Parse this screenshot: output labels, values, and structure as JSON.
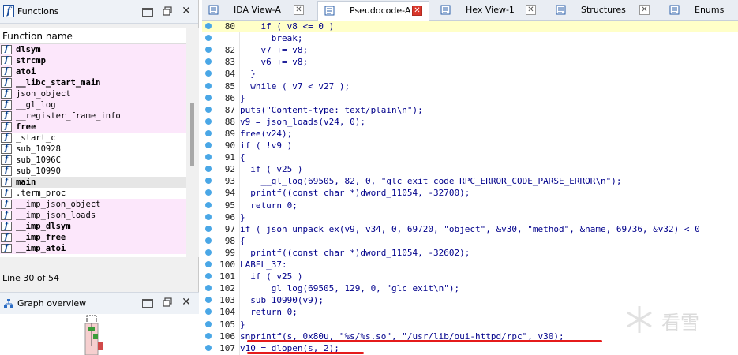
{
  "functions_panel": {
    "title": "Functions",
    "header": "Function name",
    "status": "Line 30 of 54",
    "items": [
      {
        "name": "dlsym",
        "bold": true,
        "pink": true
      },
      {
        "name": "strcmp",
        "bold": true,
        "pink": true
      },
      {
        "name": "atoi",
        "bold": true,
        "pink": true
      },
      {
        "name": "__libc_start_main",
        "bold": true,
        "pink": true
      },
      {
        "name": "json_object",
        "bold": false,
        "pink": true
      },
      {
        "name": "__gl_log",
        "bold": false,
        "pink": true
      },
      {
        "name": "__register_frame_info",
        "bold": false,
        "pink": true
      },
      {
        "name": "free",
        "bold": true,
        "pink": true
      },
      {
        "name": "_start_c",
        "bold": false,
        "pink": false
      },
      {
        "name": "sub_10928",
        "bold": false,
        "pink": false
      },
      {
        "name": "sub_1096C",
        "bold": false,
        "pink": false
      },
      {
        "name": "sub_10990",
        "bold": false,
        "pink": false
      },
      {
        "name": "main",
        "bold": true,
        "pink": false,
        "selected": true
      },
      {
        "name": ".term_proc",
        "bold": false,
        "pink": false
      },
      {
        "name": "__imp_json_object",
        "bold": false,
        "pink": true
      },
      {
        "name": "__imp_json_loads",
        "bold": false,
        "pink": true
      },
      {
        "name": "__imp_dlsym",
        "bold": true,
        "pink": true
      },
      {
        "name": "__imp_free",
        "bold": true,
        "pink": true
      },
      {
        "name": "__imp_atoi",
        "bold": true,
        "pink": true
      }
    ]
  },
  "graph_panel": {
    "title": "Graph overview"
  },
  "tabs": [
    {
      "label": "IDA View-A",
      "icon": "ida-view-icon",
      "active": false
    },
    {
      "label": "Pseudocode-A",
      "icon": "pseudocode-icon",
      "active": true
    },
    {
      "label": "Hex View-1",
      "icon": "hex-view-icon",
      "active": false
    },
    {
      "label": "Structures",
      "icon": "structures-icon",
      "active": false
    },
    {
      "label": "Enums",
      "icon": "enums-icon",
      "active": false
    }
  ],
  "code": [
    {
      "n": "80",
      "t": "    if ( v8 <= 0 )",
      "hl": true
    },
    {
      "n": "",
      "t": "      break;"
    },
    {
      "n": "82",
      "t": "    v7 += v8;"
    },
    {
      "n": "83",
      "t": "    v6 += v8;"
    },
    {
      "n": "84",
      "t": "  }"
    },
    {
      "n": "85",
      "t": "  while ( v7 < v27 );"
    },
    {
      "n": "86",
      "t": "}"
    },
    {
      "n": "87",
      "t": "puts(\"Content-type: text/plain\\n\");"
    },
    {
      "n": "88",
      "t": "v9 = json_loads(v24, 0);"
    },
    {
      "n": "89",
      "t": "free(v24);"
    },
    {
      "n": "90",
      "t": "if ( !v9 )"
    },
    {
      "n": "91",
      "t": "{"
    },
    {
      "n": "92",
      "t": "  if ( v25 )"
    },
    {
      "n": "93",
      "t": "    __gl_log(69505, 82, 0, \"glc exit code RPC_ERROR_CODE_PARSE_ERROR\\n\");"
    },
    {
      "n": "94",
      "t": "  printf((const char *)dword_11054, -32700);"
    },
    {
      "n": "95",
      "t": "  return 0;"
    },
    {
      "n": "96",
      "t": "}"
    },
    {
      "n": "97",
      "t": "if ( json_unpack_ex(v9, v34, 0, 69720, \"object\", &v30, \"method\", &name, 69736, &v32) < 0"
    },
    {
      "n": "98",
      "t": "{"
    },
    {
      "n": "99",
      "t": "  printf((const char *)dword_11054, -32602);"
    },
    {
      "n": "100",
      "t": "LABEL_37:"
    },
    {
      "n": "101",
      "t": "  if ( v25 )"
    },
    {
      "n": "102",
      "t": "    __gl_log(69505, 129, 0, \"glc exit\\n\");"
    },
    {
      "n": "103",
      "t": "  sub_10990(v9);"
    },
    {
      "n": "104",
      "t": "  return 0;"
    },
    {
      "n": "105",
      "t": "}"
    },
    {
      "n": "106",
      "t": "snprintf(s, 0x80u, \"%s/%s.so\", \"/usr/lib/oui-httpd/rpc\", v30);"
    },
    {
      "n": "107",
      "t": "v10 = dlopen(s, 2);"
    }
  ],
  "watermark": {
    "text": "看雪"
  },
  "colors": {
    "accent": "#4aa7e6",
    "underline": "#e51b1b",
    "pink_row": "#fce7fb",
    "active_close": "#d9362a"
  }
}
